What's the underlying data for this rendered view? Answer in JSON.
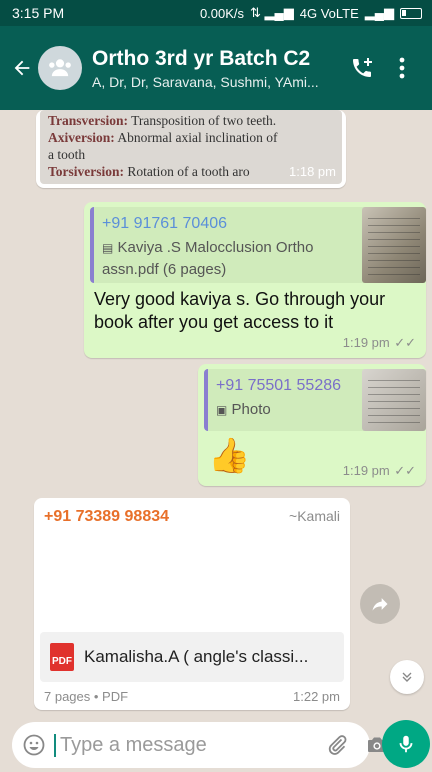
{
  "status_bar": {
    "time": "3:15 PM",
    "network": "0.00K/s",
    "signal": "4G VoLTE"
  },
  "header": {
    "title": "Ortho 3rd yr Batch C2",
    "subtitle": "A, Dr, Dr, Saravana, Sushmi, YAmi..."
  },
  "messages": {
    "image_msg": {
      "lines": [
        {
          "term": "Transversion:",
          "desc": "Transposition of two teeth."
        },
        {
          "term": "Axiversion:",
          "desc": "Abnormal axial inclination of"
        },
        {
          "term": "",
          "desc": "a tooth"
        },
        {
          "term": "Torsiversion:",
          "desc": "Rotation of a tooth aro"
        }
      ],
      "time": "1:18 pm"
    },
    "reply1": {
      "quote_sender": "+91 91761 70406",
      "quote_text_1": "Kaviya .S Malocclusion Ortho",
      "quote_text_2": "assn.pdf (6 pages)",
      "text": "Very good kaviya s. Go through your book after you get access to it",
      "time": "1:19 pm"
    },
    "reply2": {
      "quote_sender": "+91 75501 55286",
      "quote_text": "Photo",
      "emoji": "👍",
      "time": "1:19 pm"
    },
    "doc_msg": {
      "sender": "+91 73389 98834",
      "sender_name": "~Kamali",
      "file_name": "Kamalisha.A ( angle's classi...",
      "file_type_badge": "PDF",
      "meta": "7 pages • PDF",
      "time": "1:22 pm"
    }
  },
  "composer": {
    "placeholder": "Type a message"
  },
  "colors": {
    "header": "#075e54",
    "outgoing": "#dcf8c6",
    "incoming": "#ffffff",
    "sender_orange": "#e8702a",
    "quote_blue": "#3a7bd5",
    "accent_green": "#00a884"
  }
}
